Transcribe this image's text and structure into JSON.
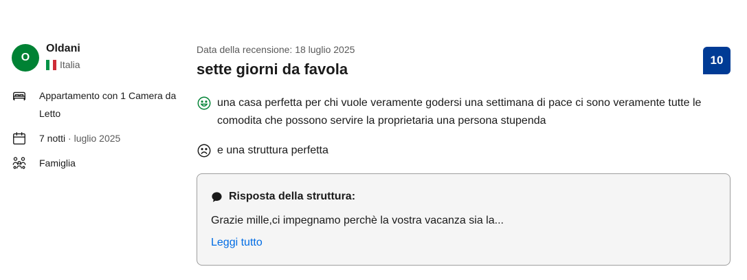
{
  "reviewer": {
    "initial": "O",
    "name": "Oldani",
    "country": "Italia",
    "avatar_color": "#008234"
  },
  "stay": {
    "room": "Appartamento con 1 Camera da Letto",
    "nights": "7 notti",
    "separator": " · ",
    "month": "luglio 2025",
    "traveler_type": "Famiglia"
  },
  "review": {
    "date_label": "Data della recensione: 18 luglio 2025",
    "title": "sette giorni da favola",
    "score": "10",
    "score_color": "#003b95",
    "positive": "una casa perfetta per chi vuole veramente godersi una settimana di pace ci sono veramente tutte le comodita che possono servire la proprietaria una persona stupenda",
    "negative": "e una struttura perfetta"
  },
  "response": {
    "heading": "Risposta della struttura:",
    "text": "Grazie mille,ci impegnamo perchè la vostra vacanza sia la...",
    "read_more": "Leggi tutto",
    "link_color": "#006ce4"
  },
  "icons": {
    "bed": "bed-icon",
    "calendar": "calendar-icon",
    "group": "group-icon",
    "happy": "smiley-happy-icon",
    "sad": "smiley-sad-icon",
    "bubble": "speech-bubble-icon"
  }
}
